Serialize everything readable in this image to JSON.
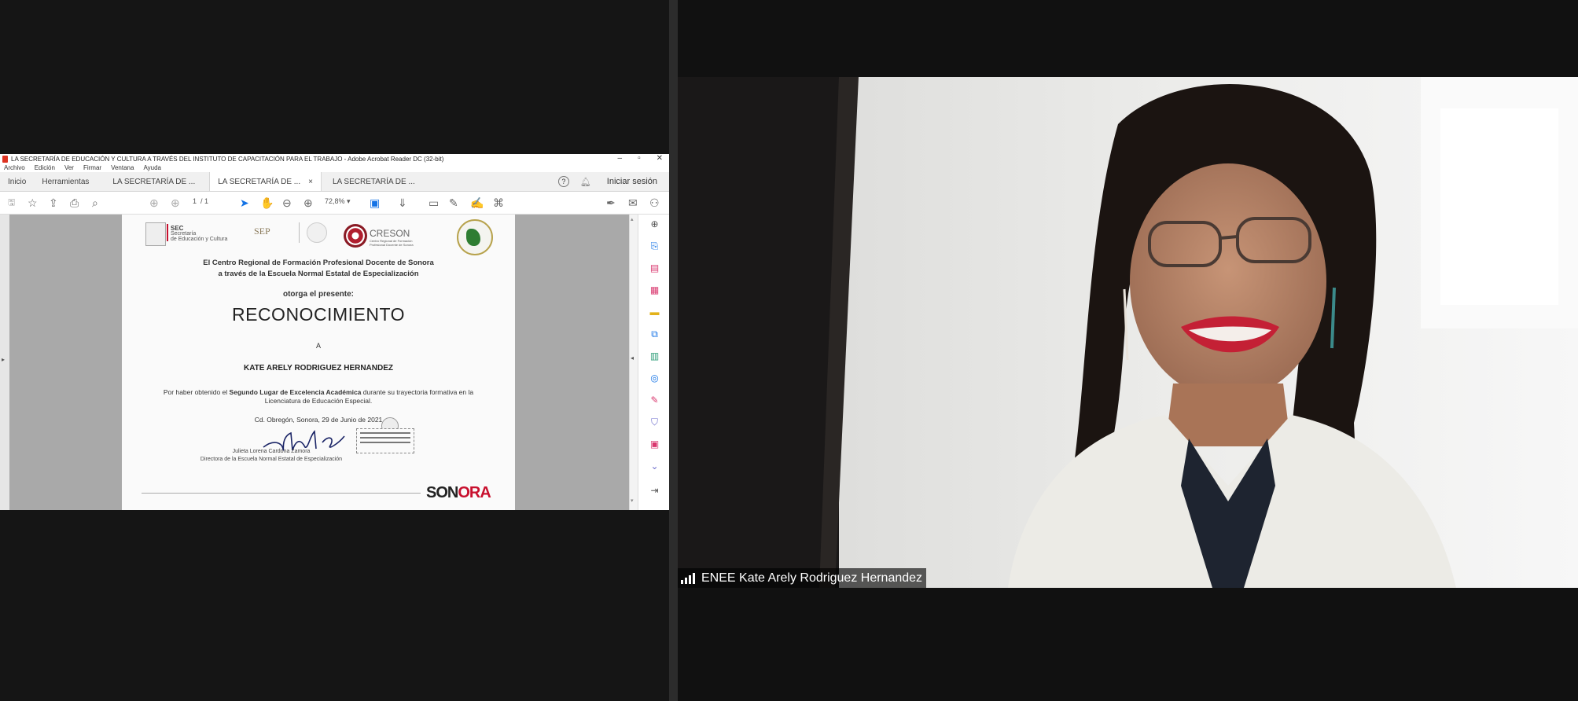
{
  "acrobat": {
    "window_title": "LA SECRETARÍA DE EDUCACIÓN Y CULTURA A TRAVÉS DEL INSTITUTO DE CAPACITACIÓN PARA EL TRABAJO - Adobe Acrobat Reader DC (32-bit)",
    "window_buttons": [
      "–",
      "▫",
      "✕"
    ],
    "menu": [
      "Archivo",
      "Edición",
      "Ver",
      "Firmar",
      "Ventana",
      "Ayuda"
    ],
    "tabs": [
      {
        "label": "Inicio"
      },
      {
        "label": "Herramientas"
      },
      {
        "label": "LA SECRETARÍA DE ..."
      },
      {
        "label": "LA SECRETARÍA DE ...",
        "active": true,
        "close": "×"
      },
      {
        "label": "LA SECRETARÍA DE ..."
      }
    ],
    "help_symbol": "?",
    "signin_label": "Iniciar sesión",
    "toolbar": {
      "page_current": "1",
      "page_total": "/ 1",
      "zoom": "72,8%"
    }
  },
  "certificate": {
    "logo_sec_title": "SEC",
    "logo_sec_sub1": "Secretaría",
    "logo_sec_sub2": "de Educación y Cultura",
    "logo_sep": "SEP",
    "logo_creson": "CRESON",
    "logo_creson_sub": "Centro Regional de Formación Profesional Docente de Sonora",
    "line1": "El Centro Regional de Formación Profesional Docente de Sonora",
    "line2": "a través de la Escuela Normal Estatal de Especialización",
    "otorga": "otorga el presente:",
    "title": "RECONOCIMIENTO",
    "a": "A",
    "recipient": "KATE ARELY RODRIGUEZ HERNANDEZ",
    "body_pre": "Por haber obtenido el ",
    "body_bold": "Segundo Lugar de Excelencia Académica",
    "body_post": " durante su trayectoria formativa en la",
    "body_line2": "Licenciatura de Educación Especial.",
    "place_date": "Cd. Obregón, Sonora, 29 de Junio de 2021",
    "signer_name": "Julieta Lorena Cardona Zamora",
    "signer_role": "Directora de la Escuela Normal Estatal de Especialización",
    "sonora_logo": "SONORA"
  },
  "video": {
    "participant_name": "ENEE Kate Arely Rodriguez Hernandez"
  }
}
